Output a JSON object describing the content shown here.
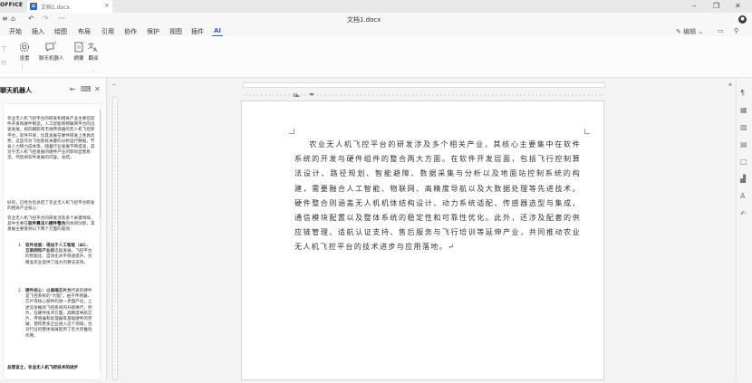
{
  "app": {
    "brand": "OFFICE"
  },
  "tab": {
    "name": "文档1.docx",
    "close": "×"
  },
  "window": {
    "minimize": "–",
    "restore": "❐",
    "close": "✕"
  },
  "quick_access": {
    "home": "⌂",
    "undo": "↶",
    "redo": "↷",
    "more": "···"
  },
  "doc_title": "文档1.docx",
  "menu": [
    {
      "label": "开始"
    },
    {
      "label": "插入"
    },
    {
      "label": "绘图"
    },
    {
      "label": "布局"
    },
    {
      "label": "引用"
    },
    {
      "label": "协作"
    },
    {
      "label": "保护"
    },
    {
      "label": "视图"
    },
    {
      "label": "插件"
    },
    {
      "label": "AI"
    }
  ],
  "active_menu": "AI",
  "edit_mode": {
    "label": "编辑"
  },
  "ribbon": {
    "settings_label": "设置",
    "chatbot_label": "聊天机器人",
    "summary_label": "摘要",
    "translate_label": "翻译"
  },
  "panel": {
    "title": "聊天机器人",
    "pin": "⇤",
    "kbd": "⌨",
    "close": "✕",
    "para1": "农业无人机飞控平台的研发和相关产业主要在软件开发和硬件制造。人工智能和物联网平台的迅速发展，如同摄影和无线传感器的无人机飞控新平台，软件开发，比其发展在硬件研发上更具优势。这些作为飞控系统关键的分析运行数据，节省人力物力成本等，随着行业发展不断提高，其对于无人机飞控发展的硬件产业的影响显而易见，然后将软件发展的内容。总结。",
    "para2": "好的，已经为您总结了农业无人机飞控平台研发的相关产业核心：",
    "para3_pre": "农业无人机飞控平台的研发涉及多个关键领域，其中主要在",
    "para3_b1": "软件算法",
    "para3_mid": "和",
    "para3_b2": "硬件整合",
    "para3_post": "的协同创新，其发展主要受到以下两个方面的驱动：",
    "item1_head": "软件层面：",
    "item1_b": "得益于人工智能（AI）、互联网和产业的",
    "item1_text": "迅猛发展，飞控平台的智能化、自动化水平快速提升，为精准农业提供了强大的算法支持。",
    "item2_head": "硬件核心：",
    "item2_b": "以高端芯片为",
    "item2_text": "代表的硬件是飞控系统的\"大脑\"。由于传感器、芯片等核心部件的进一步国产化，上述竞争推动飞控系统的升级换代。另外，在硬件技术方面，高精度导航芯片、传感器和处理器等基础硬件的突破，使得更多企业进入这个领域，也对行业的整体发展起到了巨大的推动作用。",
    "footer": "总而言之，农业无人机飞控技术的进步"
  },
  "doc": {
    "body": "农业无人机飞控平台的研发涉及多个相关产业，其核心主要集中在软件系统的开发与硬件组件的整合两大方面。在软件开发层面，包括飞行控制算法设计、路径规划、智能避障、数据采集与分析以及地面站控制系统的构建，需要融合人工智能、物联网、高精度导航以及大数据处理等先进技术。硬件整合则涵盖无人机机体结构设计、动力系统适配、传感器选型与集成、通信模块配置以及整体系统的稳定性和可靠性优化。此外，还涉及配套的供应链管理、适航认证支持、售后服务与飞行培训等延伸产业，共同推动农业无人机飞控平台的技术进步与应用落地。↵"
  },
  "icons": [
    "settings-icon",
    "chatbot-icon",
    "summary-icon",
    "translate-icon",
    "pin-icon",
    "keyboard-icon",
    "close-icon",
    "paragraph-icon",
    "table-icon",
    "image-icon",
    "header-icon",
    "shape-icon",
    "chart-icon",
    "text-art-icon",
    "signature-icon"
  ],
  "colors": {
    "accent": "#2f64d6",
    "page_bg": "#f3f3f3",
    "doc_text": "#333333"
  }
}
